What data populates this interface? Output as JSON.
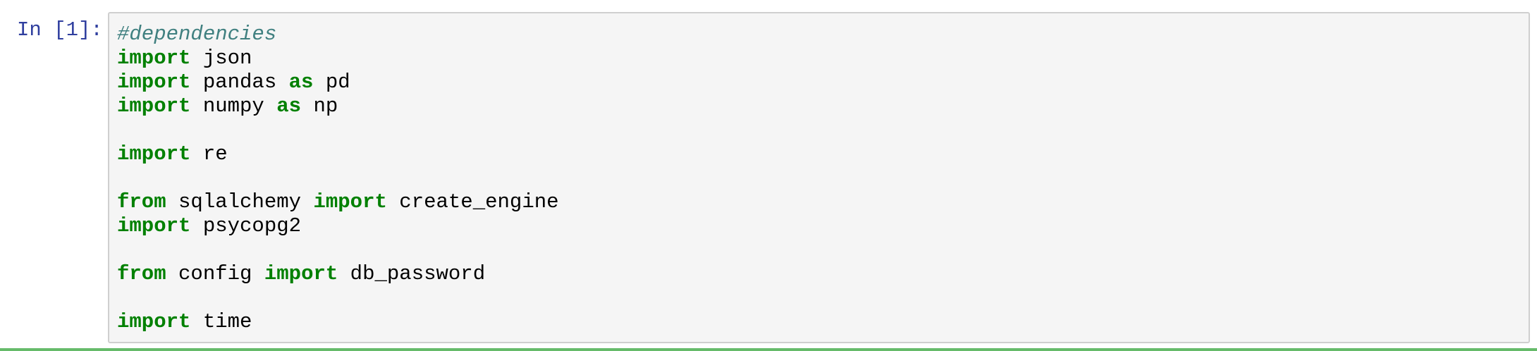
{
  "cell": {
    "prompt": "In [1]:",
    "lines": [
      [
        {
          "t": "#dependencies",
          "k": "comment"
        }
      ],
      [
        {
          "t": "import",
          "k": "kw"
        },
        {
          "t": " json",
          "k": "ident"
        }
      ],
      [
        {
          "t": "import",
          "k": "kw"
        },
        {
          "t": " pandas ",
          "k": "ident"
        },
        {
          "t": "as",
          "k": "kw"
        },
        {
          "t": " pd",
          "k": "ident"
        }
      ],
      [
        {
          "t": "import",
          "k": "kw"
        },
        {
          "t": " numpy ",
          "k": "ident"
        },
        {
          "t": "as",
          "k": "kw"
        },
        {
          "t": " np",
          "k": "ident"
        }
      ],
      [],
      [
        {
          "t": "import",
          "k": "kw"
        },
        {
          "t": " re",
          "k": "ident"
        }
      ],
      [],
      [
        {
          "t": "from",
          "k": "kw"
        },
        {
          "t": " sqlalchemy ",
          "k": "ident"
        },
        {
          "t": "import",
          "k": "kw"
        },
        {
          "t": " create_engine",
          "k": "ident"
        }
      ],
      [
        {
          "t": "import",
          "k": "kw"
        },
        {
          "t": " psycopg2",
          "k": "ident"
        }
      ],
      [],
      [
        {
          "t": "from",
          "k": "kw"
        },
        {
          "t": " config ",
          "k": "ident"
        },
        {
          "t": "import",
          "k": "kw"
        },
        {
          "t": " db_password",
          "k": "ident"
        }
      ],
      [],
      [
        {
          "t": "import",
          "k": "kw"
        },
        {
          "t": " time",
          "k": "ident"
        }
      ]
    ]
  },
  "colors": {
    "prompt": "#303f9f",
    "keyword": "#008000",
    "comment": "#408080",
    "cell_background": "#f5f5f5",
    "cell_border": "#cfcfcf",
    "selected_cell_rule": "#66bb6a"
  }
}
